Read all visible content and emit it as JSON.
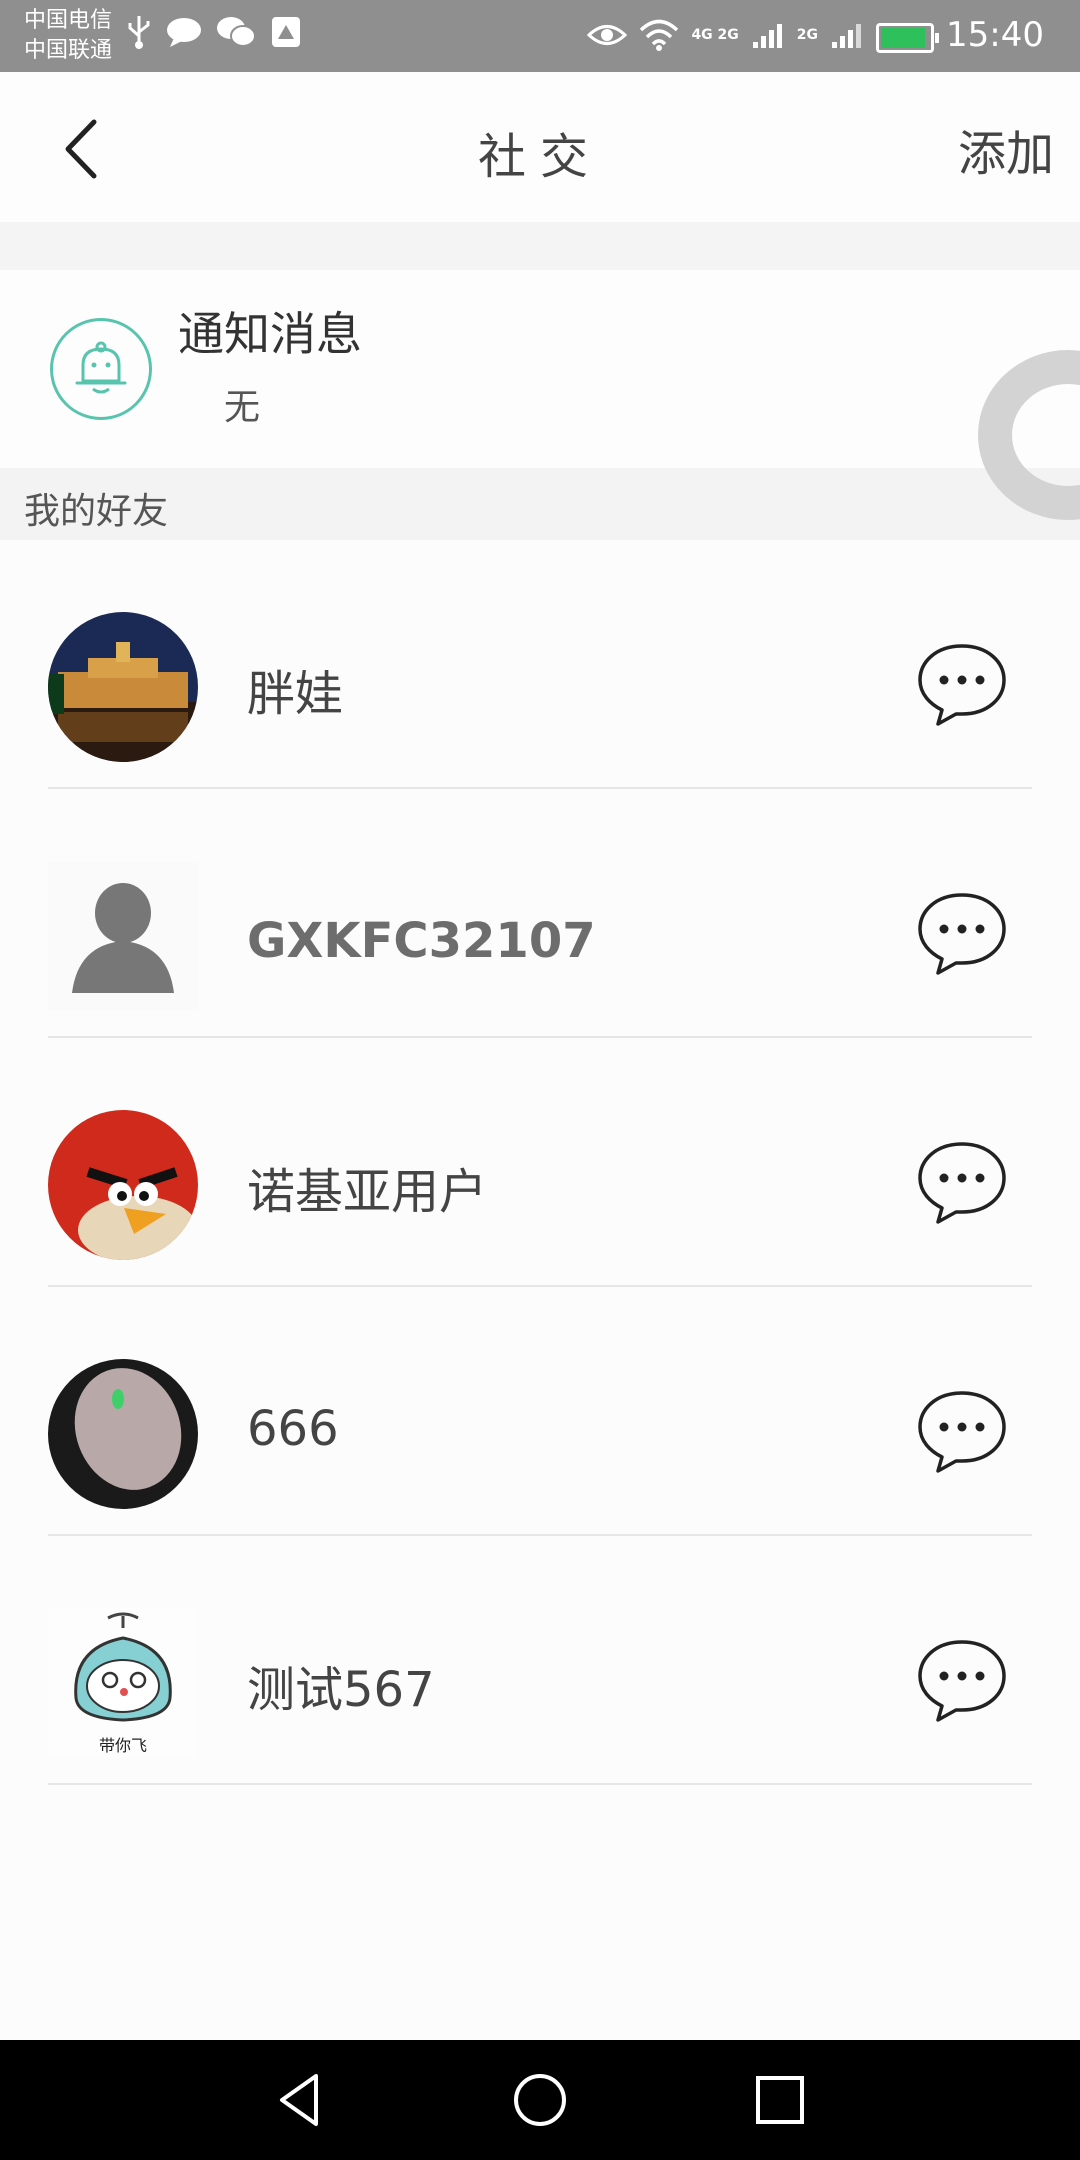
{
  "status_bar": {
    "carrier_1": "中国电信",
    "carrier_2": "中国联通",
    "network_1": "4G 2G",
    "network_2": "2G",
    "time": "15:40",
    "icons": [
      "usb-icon",
      "message-icon",
      "wechat-icon",
      "app-icon",
      "eye-icon",
      "wifi-icon",
      "signal-icon",
      "battery-icon"
    ]
  },
  "header": {
    "title": "社交",
    "add_label": "添加",
    "back_icon": "chevron-left-icon"
  },
  "notification": {
    "title": "通知消息",
    "subtitle": "无",
    "icon": "bell-icon",
    "accent": "#58c4ad"
  },
  "friends_section": {
    "title": "我的好友",
    "friends": [
      {
        "name": "胖娃",
        "avatar": "night-palace-photo"
      },
      {
        "name": "GXKFC32107",
        "avatar": "default-silhouette"
      },
      {
        "name": "诺基亚用户",
        "avatar": "angry-bird"
      },
      {
        "name": "666",
        "avatar": "mouse-photo"
      },
      {
        "name": "测试567",
        "avatar": "cartoon-cat",
        "avatar_caption": "带你飞"
      }
    ]
  },
  "nav": {
    "icons": [
      "back-triangle-icon",
      "home-circle-icon",
      "recents-square-icon"
    ]
  }
}
